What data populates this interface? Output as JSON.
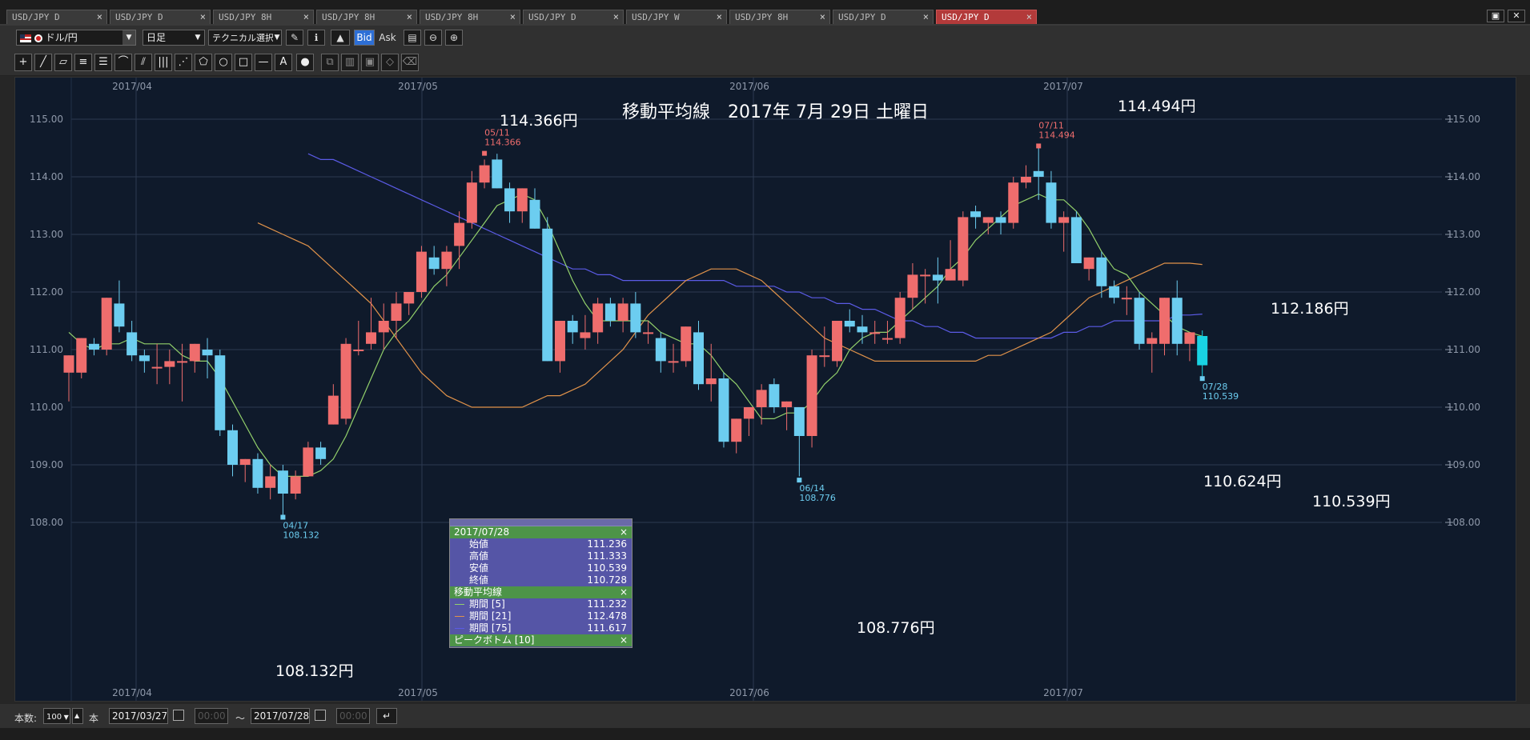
{
  "tabs": [
    {
      "label": "USD/JPY D",
      "active": false
    },
    {
      "label": "USD/JPY D",
      "active": false
    },
    {
      "label": "USD/JPY 8H",
      "active": false
    },
    {
      "label": "USD/JPY 8H",
      "active": false
    },
    {
      "label": "USD/JPY 8H",
      "active": false
    },
    {
      "label": "USD/JPY D",
      "active": false
    },
    {
      "label": "USD/JPY W",
      "active": false
    },
    {
      "label": "USD/JPY 8H",
      "active": false
    },
    {
      "label": "USD/JPY D",
      "active": false
    },
    {
      "label": "USD/JPY D",
      "active": true
    }
  ],
  "toolbar": {
    "symbol": "ドル/円",
    "timeframe": "日足",
    "technical": "テクニカル選択",
    "bid": "Bid",
    "ask": "Ask"
  },
  "drawing_tools": [
    "crosshair-tool",
    "trendline-tool",
    "ruler-tool",
    "hline-tool",
    "channel-tool",
    "arc-tool",
    "fan-tool",
    "vline-tool",
    "pitchfork-tool",
    "polygon-tool",
    "circle-tool",
    "rectangle-tool",
    "horizontal-line-tool",
    "text-tool",
    "icon-tool",
    "copy-tool",
    "layers-tool",
    "save-tool",
    "eraser-tool",
    "delete-tool"
  ],
  "chart_data": {
    "type": "candlestick",
    "title": "移動平均線　2017年 7月 29日 土曜日",
    "y_ticks": [
      "115.00",
      "114.00",
      "113.00",
      "112.00",
      "111.00",
      "110.00",
      "109.00",
      "108.00"
    ],
    "x_ticks": [
      "2017/04",
      "2017/05",
      "2017/06",
      "2017/07"
    ],
    "ylim": [
      107.4,
      115.3
    ],
    "grid": true,
    "colors": {
      "up": "#ef6d6d",
      "down": "#6ccdf0",
      "last": "#19d3e3",
      "ma5": "#92d06b",
      "ma21": "#e0924a",
      "ma75": "#5b5be6",
      "background": "#0f1a2b"
    },
    "candles": [
      [
        110.6,
        110.9,
        110.1,
        110.9
      ],
      [
        110.6,
        111.2,
        110.5,
        111.2
      ],
      [
        111.1,
        111.2,
        110.9,
        111.0
      ],
      [
        111.0,
        111.9,
        110.9,
        111.9
      ],
      [
        111.8,
        112.2,
        111.3,
        111.4
      ],
      [
        111.3,
        111.5,
        110.8,
        110.9
      ],
      [
        110.9,
        111.0,
        110.6,
        110.8
      ],
      [
        110.7,
        111.1,
        110.4,
        110.7
      ],
      [
        110.7,
        111.0,
        110.4,
        110.8
      ],
      [
        110.8,
        111.1,
        110.1,
        110.8
      ],
      [
        110.8,
        111.1,
        110.6,
        111.1
      ],
      [
        111.0,
        111.2,
        110.5,
        110.9
      ],
      [
        110.9,
        111.0,
        109.5,
        109.6
      ],
      [
        109.6,
        109.7,
        108.8,
        109.0
      ],
      [
        109.0,
        109.1,
        108.7,
        109.1
      ],
      [
        109.1,
        109.2,
        108.5,
        108.6
      ],
      [
        108.6,
        109.0,
        108.4,
        108.8
      ],
      [
        108.9,
        109.0,
        108.1,
        108.5
      ],
      [
        108.5,
        108.9,
        108.4,
        108.8
      ],
      [
        108.8,
        109.4,
        108.8,
        109.3
      ],
      [
        109.3,
        109.4,
        109.0,
        109.1
      ],
      [
        109.7,
        110.4,
        109.7,
        110.2
      ],
      [
        109.8,
        111.2,
        109.7,
        111.1
      ],
      [
        111.0,
        111.5,
        110.9,
        111.0
      ],
      [
        111.1,
        111.9,
        111.0,
        111.3
      ],
      [
        111.3,
        111.8,
        111.0,
        111.5
      ],
      [
        111.5,
        112.0,
        111.2,
        111.8
      ],
      [
        111.8,
        112.0,
        111.6,
        112.0
      ],
      [
        112.0,
        112.8,
        111.9,
        112.7
      ],
      [
        112.6,
        112.8,
        112.3,
        112.4
      ],
      [
        112.4,
        112.8,
        112.1,
        112.7
      ],
      [
        112.8,
        113.4,
        112.4,
        113.2
      ],
      [
        113.2,
        114.1,
        113.1,
        113.9
      ],
      [
        113.9,
        114.3,
        113.8,
        114.2
      ],
      [
        114.3,
        114.4,
        113.8,
        113.8
      ],
      [
        113.8,
        113.9,
        113.2,
        113.4
      ],
      [
        113.4,
        113.8,
        113.2,
        113.8
      ],
      [
        113.6,
        113.8,
        113.1,
        113.1
      ],
      [
        113.1,
        113.3,
        110.8,
        110.8
      ],
      [
        110.8,
        111.5,
        110.6,
        111.5
      ],
      [
        111.5,
        111.6,
        111.1,
        111.3
      ],
      [
        111.2,
        111.6,
        111.0,
        111.3
      ],
      [
        111.3,
        111.9,
        111.1,
        111.8
      ],
      [
        111.8,
        111.9,
        111.4,
        111.5
      ],
      [
        111.5,
        111.9,
        111.3,
        111.8
      ],
      [
        111.8,
        112.0,
        111.2,
        111.3
      ],
      [
        111.3,
        111.5,
        111.1,
        111.3
      ],
      [
        111.2,
        111.3,
        110.6,
        110.8
      ],
      [
        110.8,
        111.1,
        110.6,
        110.8
      ],
      [
        110.8,
        111.4,
        110.7,
        111.4
      ],
      [
        111.3,
        111.5,
        110.3,
        110.4
      ],
      [
        110.4,
        111.1,
        110.1,
        110.5
      ],
      [
        110.5,
        110.6,
        109.3,
        109.4
      ],
      [
        109.4,
        109.8,
        109.2,
        109.8
      ],
      [
        109.8,
        110.0,
        109.5,
        110.0
      ],
      [
        110.0,
        110.4,
        109.7,
        110.3
      ],
      [
        110.4,
        110.5,
        109.9,
        110.0
      ],
      [
        110.0,
        110.1,
        109.6,
        110.1
      ],
      [
        110.0,
        110.0,
        108.8,
        109.5
      ],
      [
        109.5,
        111.0,
        109.3,
        110.9
      ],
      [
        110.9,
        111.4,
        110.7,
        110.9
      ],
      [
        110.8,
        111.5,
        110.7,
        111.5
      ],
      [
        111.5,
        111.7,
        111.3,
        111.4
      ],
      [
        111.4,
        111.6,
        111.1,
        111.3
      ],
      [
        111.3,
        111.5,
        111.1,
        111.3
      ],
      [
        111.2,
        111.5,
        111.1,
        111.2
      ],
      [
        111.2,
        112.0,
        111.1,
        111.9
      ],
      [
        111.9,
        112.5,
        111.7,
        112.3
      ],
      [
        112.3,
        112.4,
        111.8,
        112.3
      ],
      [
        112.3,
        112.6,
        111.8,
        112.2
      ],
      [
        112.2,
        112.9,
        112.2,
        112.4
      ],
      [
        112.2,
        113.4,
        112.1,
        113.3
      ],
      [
        113.4,
        113.5,
        113.1,
        113.3
      ],
      [
        113.2,
        113.3,
        113.0,
        113.3
      ],
      [
        113.3,
        113.4,
        113.0,
        113.2
      ],
      [
        113.2,
        114.0,
        113.1,
        113.9
      ],
      [
        113.9,
        114.2,
        113.8,
        114.0
      ],
      [
        114.1,
        114.5,
        113.6,
        114.0
      ],
      [
        113.9,
        114.1,
        113.1,
        113.2
      ],
      [
        113.2,
        113.4,
        112.7,
        113.3
      ],
      [
        113.3,
        113.4,
        112.5,
        112.5
      ],
      [
        112.4,
        112.6,
        112.2,
        112.6
      ],
      [
        112.6,
        112.7,
        111.9,
        112.1
      ],
      [
        112.1,
        112.2,
        111.8,
        111.9
      ],
      [
        111.9,
        112.1,
        111.6,
        111.9
      ],
      [
        111.9,
        112.0,
        111.0,
        111.1
      ],
      [
        111.1,
        111.3,
        110.6,
        111.2
      ],
      [
        111.1,
        111.9,
        110.9,
        111.9
      ],
      [
        111.9,
        112.2,
        110.9,
        111.1
      ],
      [
        111.1,
        111.3,
        110.8,
        111.3
      ],
      [
        111.236,
        111.333,
        110.539,
        110.728
      ]
    ],
    "ma5": [
      111.3,
      111.1,
      111.0,
      111.1,
      111.1,
      111.2,
      111.1,
      111.1,
      111.1,
      110.9,
      110.8,
      110.8,
      110.5,
      110.1,
      109.7,
      109.3,
      109.0,
      108.8,
      108.8,
      108.8,
      108.9,
      109.1,
      109.5,
      110.0,
      110.5,
      111.0,
      111.3,
      111.5,
      111.8,
      112.1,
      112.3,
      112.6,
      112.9,
      113.2,
      113.5,
      113.6,
      113.7,
      113.6,
      113.2,
      112.7,
      112.2,
      111.8,
      111.5,
      111.5,
      111.5,
      111.5,
      111.5,
      111.3,
      111.2,
      111.1,
      111.1,
      110.9,
      110.6,
      110.4,
      110.1,
      109.8,
      109.8,
      109.9,
      109.9,
      110.1,
      110.4,
      110.6,
      111.0,
      111.2,
      111.3,
      111.3,
      111.5,
      111.7,
      111.9,
      112.1,
      112.4,
      112.6,
      112.9,
      113.1,
      113.3,
      113.5,
      113.6,
      113.7,
      113.6,
      113.6,
      113.4,
      113.1,
      112.7,
      112.4,
      112.3,
      112.0,
      111.8,
      111.6,
      111.4,
      111.3,
      111.232
    ],
    "ma21": [
      113.2,
      113.1,
      113.0,
      112.9,
      112.8,
      112.6,
      112.4,
      112.2,
      112.0,
      111.8,
      111.5,
      111.2,
      110.9,
      110.6,
      110.4,
      110.2,
      110.1,
      110.0,
      110.0,
      110.0,
      110.0,
      110.0,
      110.1,
      110.2,
      110.2,
      110.3,
      110.4,
      110.6,
      110.8,
      111.0,
      111.3,
      111.6,
      111.8,
      112.0,
      112.2,
      112.3,
      112.4,
      112.4,
      112.4,
      112.3,
      112.2,
      112.0,
      111.8,
      111.6,
      111.4,
      111.2,
      111.1,
      111.0,
      110.9,
      110.8,
      110.8,
      110.8,
      110.8,
      110.8,
      110.8,
      110.8,
      110.8,
      110.8,
      110.9,
      110.9,
      111.0,
      111.1,
      111.2,
      111.3,
      111.5,
      111.7,
      111.9,
      112.0,
      112.1,
      112.2,
      112.3,
      112.4,
      112.5,
      112.5,
      112.5,
      112.478
    ],
    "ma75": [
      114.4,
      114.3,
      114.3,
      114.2,
      114.1,
      114.0,
      113.9,
      113.8,
      113.7,
      113.6,
      113.5,
      113.4,
      113.3,
      113.2,
      113.1,
      113.0,
      112.9,
      112.8,
      112.7,
      112.6,
      112.5,
      112.4,
      112.4,
      112.3,
      112.3,
      112.2,
      112.2,
      112.2,
      112.2,
      112.2,
      112.2,
      112.2,
      112.2,
      112.2,
      112.1,
      112.1,
      112.1,
      112.1,
      112.0,
      112.0,
      111.9,
      111.9,
      111.8,
      111.8,
      111.7,
      111.7,
      111.6,
      111.5,
      111.5,
      111.4,
      111.4,
      111.3,
      111.3,
      111.2,
      111.2,
      111.2,
      111.2,
      111.2,
      111.2,
      111.2,
      111.3,
      111.3,
      111.4,
      111.4,
      111.5,
      111.5,
      111.5,
      111.5,
      111.5,
      111.6,
      111.6,
      111.617
    ],
    "peaks": [
      {
        "date": "05/11",
        "value": "114.366",
        "kind": "high",
        "index": 33,
        "big": "114.366円"
      },
      {
        "date": "07/11",
        "value": "114.494",
        "kind": "high",
        "index": 77,
        "big": "114.494円"
      },
      {
        "date": "04/17",
        "value": "108.132",
        "kind": "low",
        "index": 17,
        "big": "108.132円"
      },
      {
        "date": "06/14",
        "value": "108.776",
        "kind": "low",
        "index": 58,
        "big": "108.776円"
      },
      {
        "date": "07/28",
        "value": "110.539",
        "kind": "low",
        "index": 90,
        "big": "110.539円"
      }
    ],
    "annotations": [
      "112.186円",
      "110.624円"
    ]
  },
  "infobox": {
    "date": "2017/07/28",
    "rows": [
      {
        "label": "始値",
        "value": "111.236"
      },
      {
        "label": "高値",
        "value": "111.333"
      },
      {
        "label": "安値",
        "value": "110.539"
      },
      {
        "label": "終値",
        "value": "110.728"
      }
    ],
    "ma_title": "移動平均線",
    "ma_rows": [
      {
        "label": "期間 [5]",
        "value": "111.232",
        "color": "#92d06b"
      },
      {
        "label": "期間 [21]",
        "value": "112.478",
        "color": "#e0924a"
      },
      {
        "label": "期間 [75]",
        "value": "111.617",
        "color": "#5b5be6"
      }
    ],
    "peak_title": "ピークボトム [10]",
    "close": "×"
  },
  "statusbar": {
    "count_label": "本数:",
    "count_value": "100",
    "unit": "本",
    "from_date": "2017/03/27",
    "from_time": "00:00",
    "tilde": "〜",
    "to_date": "2017/07/28",
    "to_time": "00:00"
  }
}
